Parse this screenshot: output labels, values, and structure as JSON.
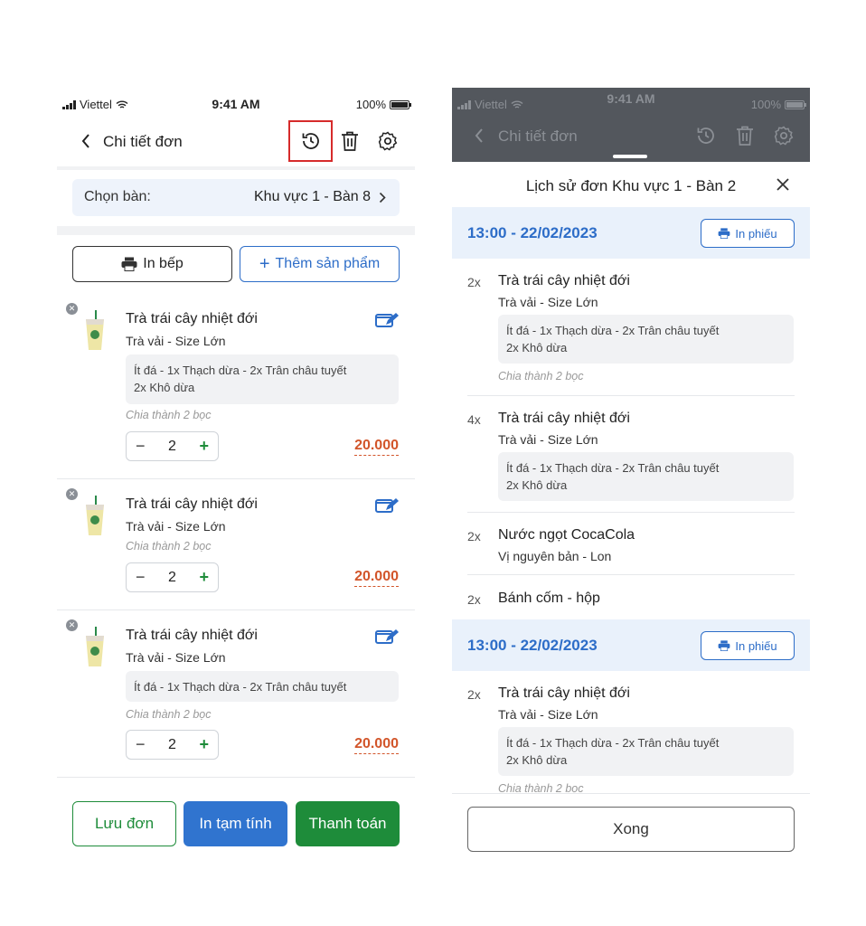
{
  "status": {
    "carrier": "Viettel",
    "time": "9:41 AM",
    "battery": "100%"
  },
  "left": {
    "title": "Chi tiết đơn",
    "table_label": "Chọn bàn:",
    "table_value": "Khu vực 1 - Bàn 8",
    "kitchen_button": "In bếp",
    "add_button": "Thêm sản phẩm",
    "items": [
      {
        "name": "Trà trái cây nhiệt đới",
        "variant": "Trà vải - Size Lớn",
        "options": [
          "Ít đá - 1x Thạch dừa - 2x Trân châu tuyết",
          "2x Khô dừa"
        ],
        "split": "Chia thành 2 bọc",
        "qty": "2",
        "price": "20.000"
      },
      {
        "name": "Trà trái cây nhiệt đới",
        "variant": "Trà vải - Size Lớn",
        "split": "Chia thành 2 bọc",
        "qty": "2",
        "price": "20.000"
      },
      {
        "name": "Trà trái cây nhiệt đới",
        "variant": "Trà vải - Size Lớn",
        "options": [
          "Ít đá - 1x Thạch dừa - 2x Trân châu tuyết"
        ],
        "split": "Chia thành 2 bọc",
        "qty": "2",
        "price": "20.000"
      }
    ],
    "footer": {
      "save": "Lưu đơn",
      "temp": "In tạm tính",
      "pay": "Thanh toán"
    }
  },
  "right": {
    "bg_title": "Chi tiết đơn",
    "sheet_title": "Lịch sử đơn Khu vực 1 - Bàn 2",
    "print_label": "In phiếu",
    "groups": [
      {
        "time": "13:00 - 22/02/2023"
      },
      {
        "time": "13:00 - 22/02/2023"
      }
    ],
    "entries": [
      {
        "qty": "2x",
        "name": "Trà trái cây nhiệt đới",
        "variant": "Trà vải - Size Lớn",
        "options": [
          "Ít đá - 1x Thạch dừa - 2x Trân châu tuyết",
          "2x Khô dừa"
        ],
        "split": "Chia thành 2 bọc"
      },
      {
        "qty": "4x",
        "name": "Trà trái cây nhiệt đới",
        "variant": "Trà vải - Size Lớn",
        "options": [
          "Ít đá - 1x Thạch dừa - 2x Trân châu tuyết",
          "2x Khô dừa"
        ]
      },
      {
        "qty": "2x",
        "name": "Nước ngọt CocaCola",
        "variant": "Vị nguyên bản - Lon"
      },
      {
        "qty": "2x",
        "name": "Bánh cốm - hộp"
      },
      {
        "qty": "2x",
        "name": "Trà trái cây nhiệt đới",
        "variant": "Trà vải - Size Lớn",
        "options": [
          "Ít đá - 1x Thạch dừa - 2x Trân châu tuyết",
          "2x Khô dừa"
        ],
        "split": "Chia thành 2 bọc"
      }
    ],
    "done_button": "Xong"
  },
  "colors": {
    "primary_blue": "#2d6dc8",
    "green": "#1e8c3a",
    "price": "#d2552a",
    "highlight": "#d62b2b"
  }
}
